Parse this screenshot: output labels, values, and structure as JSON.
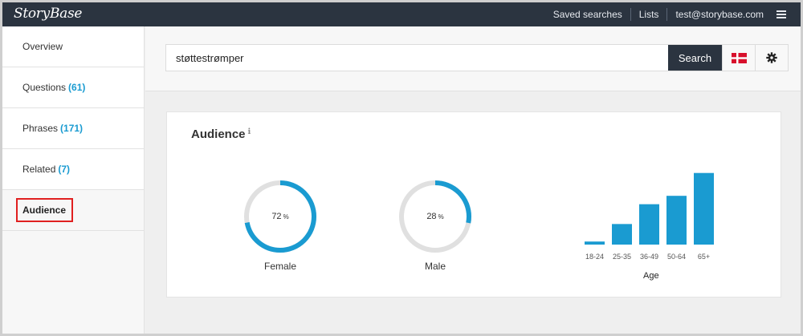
{
  "app": {
    "logo": "StoryBase",
    "nav": {
      "saved_searches": "Saved searches",
      "lists": "Lists",
      "user_email": "test@storybase.com",
      "menu_icon": "hamburger-menu-icon"
    }
  },
  "sidebar": {
    "items": [
      {
        "label": "Overview",
        "count": ""
      },
      {
        "label": "Questions",
        "count": "(61)"
      },
      {
        "label": "Phrases",
        "count": "(171)"
      },
      {
        "label": "Related",
        "count": "(7)"
      },
      {
        "label": "Audience",
        "count": ""
      }
    ],
    "active": "Audience"
  },
  "search": {
    "value": "støttestrømper",
    "button_label": "Search",
    "flag_icon": "denmark-flag-icon",
    "settings_icon": "gear-icon"
  },
  "audience": {
    "title": "Audience",
    "info_icon": "info-icon",
    "gender": [
      {
        "label": "Female",
        "percent": 72,
        "pct_text": "72",
        "unit": "%"
      },
      {
        "label": "Male",
        "percent": 28,
        "pct_text": "28",
        "unit": "%"
      }
    ],
    "age_title": "Age"
  },
  "chart_data": {
    "type": "bar",
    "categories": [
      "18-24",
      "25-35",
      "36-49",
      "50-64",
      "65+"
    ],
    "values": [
      4,
      27,
      53,
      64,
      94
    ],
    "xlabel": "Age",
    "ylabel": "",
    "ylim": [
      0,
      100
    ],
    "grid": false
  },
  "colors": {
    "accent": "#1a9bd1",
    "topbar": "#2b3440",
    "donut_track": "#e0e0e0",
    "active_outline": "#e02020"
  }
}
